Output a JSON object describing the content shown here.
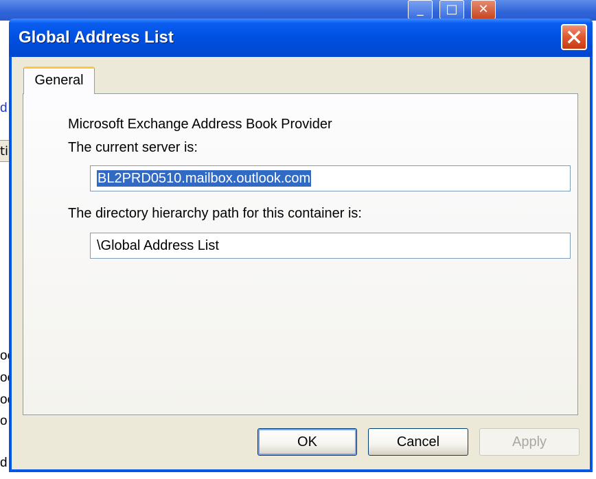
{
  "background_window": {
    "fragments": [
      "d",
      "ti",
      "oo",
      "oo",
      "oo",
      "o",
      "d"
    ]
  },
  "dialog": {
    "title": "Global Address List",
    "tabs": [
      {
        "label": "General"
      }
    ],
    "provider_text": "Microsoft Exchange Address Book Provider",
    "server_label": "The current server is:",
    "server_value": "BL2PRD0510.mailbox.outlook.com",
    "path_label": "The directory hierarchy path for this container is:",
    "path_value": "\\Global Address List"
  },
  "buttons": {
    "ok": "OK",
    "cancel": "Cancel",
    "apply": "Apply"
  },
  "colors": {
    "titlebar": "#0050e0",
    "selection": "#316ac5",
    "close_button": "#e0562f"
  },
  "icons": {
    "close": "close-icon",
    "maximize": "maximize-icon",
    "minimize": "minimize-icon"
  }
}
